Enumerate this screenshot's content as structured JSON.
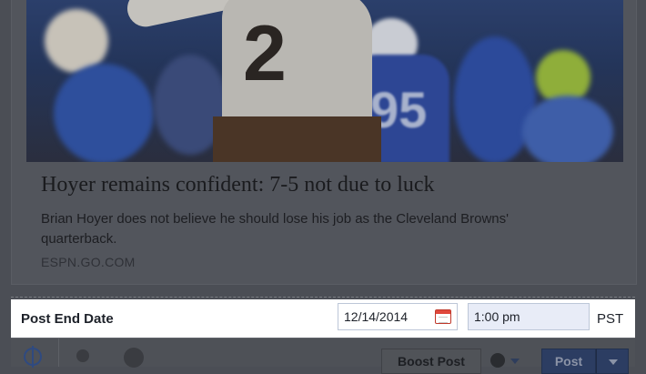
{
  "preview": {
    "headline": "Hoyer remains confident: 7-5 not due to luck",
    "summary": "Brian Hoyer does not believe he should lose his job as the Cleveland Browns' quarterback.",
    "source": "ESPN.GO.COM",
    "jersey_number": "2",
    "background_jersey_number": "95"
  },
  "end_date": {
    "label": "Post End Date",
    "date_value": "12/14/2014",
    "time_value": "1:00 pm",
    "timezone": "PST"
  },
  "toolbar": {
    "boost_label": "Boost Post",
    "post_label": "Post",
    "icons": [
      "target-icon",
      "location-pin-icon",
      "smiley-icon",
      "globe-icon",
      "caret-down-icon"
    ]
  },
  "colors": {
    "overlay_dim": "#4b4e55",
    "highlight_row": "#ffffff",
    "calendar_red": "#e0483c",
    "post_button": "#2c3d62"
  }
}
